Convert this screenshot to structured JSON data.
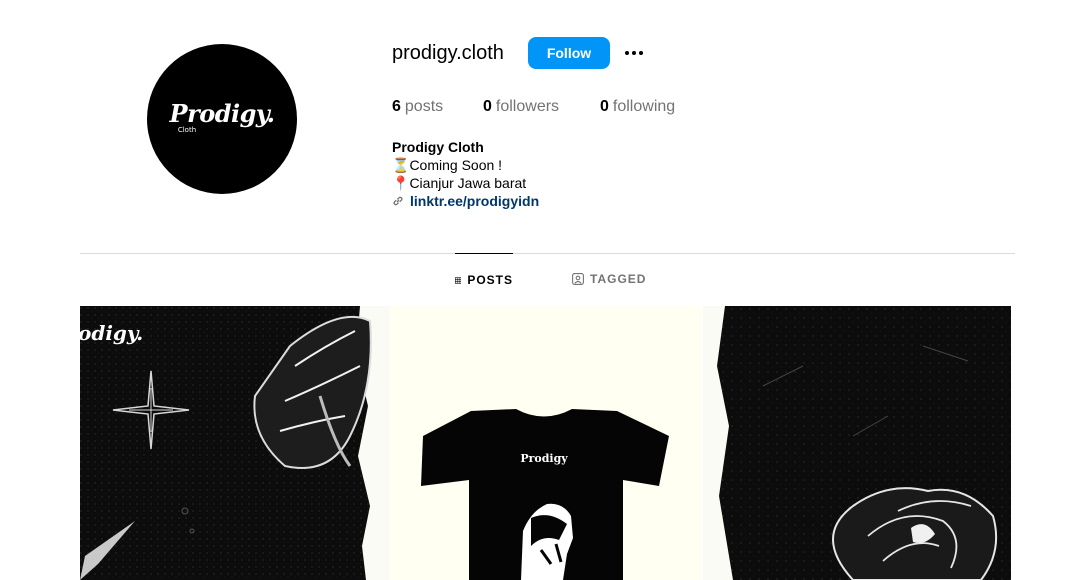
{
  "profile": {
    "username": "prodigy.cloth",
    "avatar_logo": "Prodigy.",
    "avatar_logo_sub": "Cloth",
    "follow_label": "Follow",
    "more_icon": "more-horizontal-icon"
  },
  "stats": {
    "posts_count": "6",
    "posts_label": "posts",
    "followers_count": "0",
    "followers_label": "followers",
    "following_count": "0",
    "following_label": "following"
  },
  "bio": {
    "name": "Prodigy Cloth",
    "line1_emoji": "⏳",
    "line1": "Coming Soon !",
    "line2_emoji": "📍",
    "line2": "Cianjur Jawa barat",
    "link": "linktr.ee/prodigyidn"
  },
  "tabs": [
    {
      "label": "POSTS",
      "icon": "grid-icon",
      "active": true
    },
    {
      "label": "TAGGED",
      "icon": "tagged-icon",
      "active": false
    }
  ],
  "posts": [
    {
      "logo": "odigy.",
      "theme": "butterfly-star"
    },
    {
      "tshirt_logo": "Prodigy",
      "theme": "tshirt"
    },
    {
      "theme": "rose"
    }
  ],
  "colors": {
    "accent": "#0095f6",
    "link": "#00376b",
    "muted": "#737373",
    "border": "#dbdbdb"
  }
}
